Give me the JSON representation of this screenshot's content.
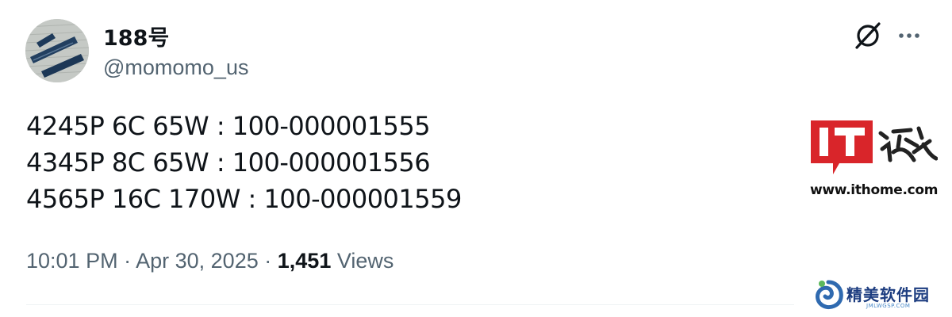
{
  "author": {
    "display_name": "188号",
    "handle": "@momomo_us",
    "avatar_icon": "avatar-photo-icon"
  },
  "actions": {
    "grok_icon": "grok-icon",
    "more_icon": "more-dots-icon"
  },
  "tweet": {
    "lines": [
      "4245P 6C 65W : 100-000001555",
      "4345P 8C 65W : 100-000001556",
      "4565P 16C 170W : 100-000001559"
    ]
  },
  "meta": {
    "time": "10:01 PM",
    "separator": "·",
    "date": "Apr 30, 2025",
    "views_count": "1,451",
    "views_label": "Views"
  },
  "watermarks": {
    "ithome_logo_text": "IT之家",
    "ithome_url": "www.ithome.com",
    "jm_text": "精美软件园",
    "jm_url": "JMLWGSP.COM"
  },
  "colors": {
    "text_primary": "#0f1419",
    "text_secondary": "#536471",
    "ithome_red": "#d9252a",
    "divider": "#eff3f4"
  }
}
